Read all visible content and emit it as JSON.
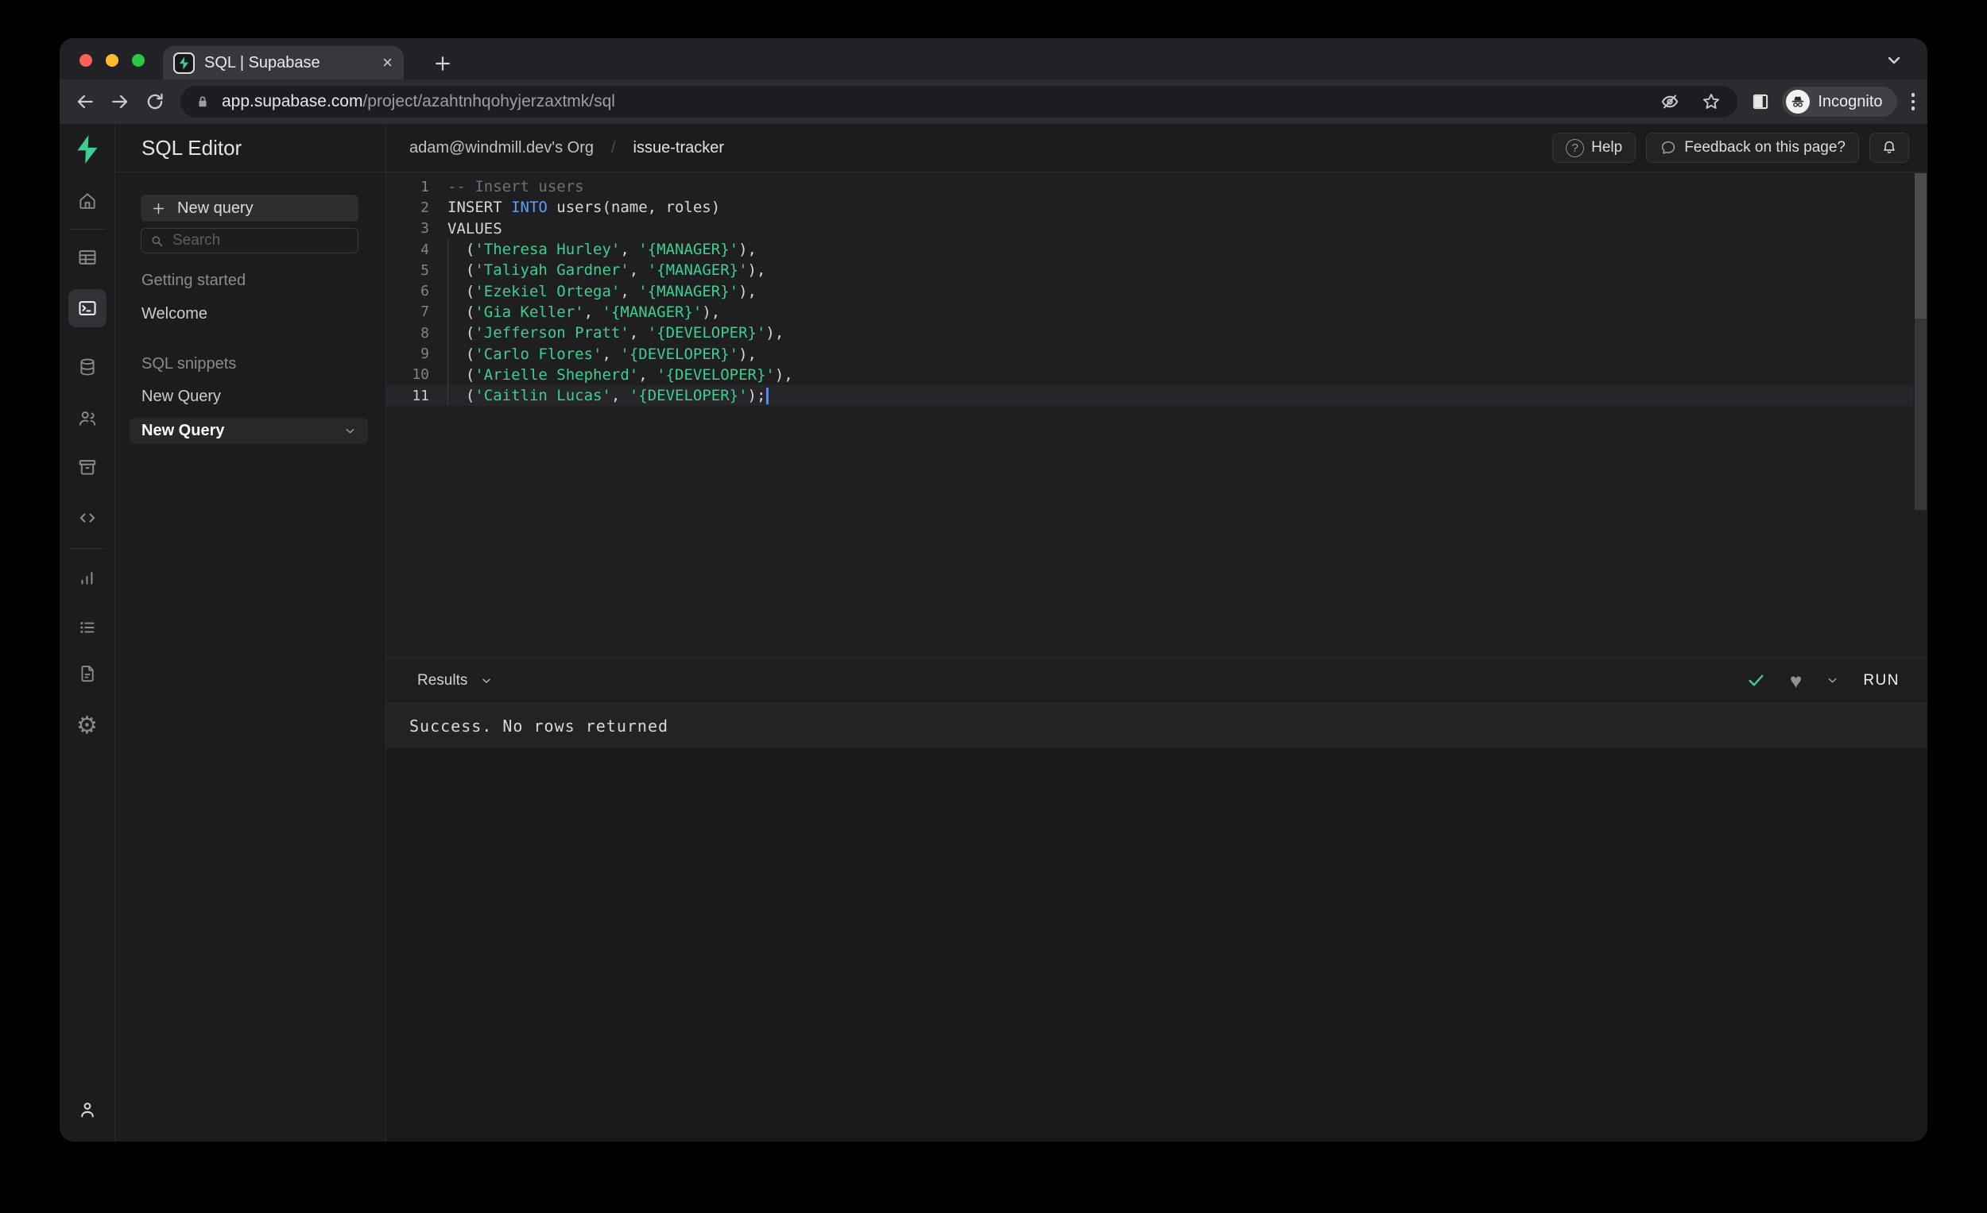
{
  "browser": {
    "tab_title": "SQL | Supabase",
    "url_host": "app.supabase.com",
    "url_path": "/project/azahtnhqohyjerzaxtmk/sql",
    "incognito_label": "Incognito"
  },
  "app": {
    "sidebar": {
      "title": "SQL Editor",
      "new_query_button": "New query",
      "search_placeholder": "Search",
      "sections": [
        {
          "label": "Getting started",
          "items": [
            {
              "label": "Welcome",
              "selected": false
            }
          ]
        },
        {
          "label": "SQL snippets",
          "items": [
            {
              "label": "New Query",
              "selected": false
            },
            {
              "label": "New Query",
              "selected": true
            }
          ]
        }
      ]
    },
    "header": {
      "org": "adam@windmill.dev's Org",
      "separator": "/",
      "project": "issue-tracker",
      "help_button": "Help",
      "feedback_button": "Feedback on this page?"
    },
    "editor": {
      "lines": [
        {
          "num": 1,
          "tokens": [
            {
              "t": "-- Insert users",
              "c": "comment"
            }
          ]
        },
        {
          "num": 2,
          "tokens": [
            {
              "t": "INSERT ",
              "c": "plain"
            },
            {
              "t": "INTO",
              "c": "keyword"
            },
            {
              "t": " users(name, roles)",
              "c": "plain"
            }
          ]
        },
        {
          "num": 3,
          "tokens": [
            {
              "t": "VALUES",
              "c": "plain"
            }
          ]
        },
        {
          "num": 4,
          "tokens": [
            {
              "t": "  (",
              "c": "plain"
            },
            {
              "t": "'Theresa Hurley'",
              "c": "string"
            },
            {
              "t": ", ",
              "c": "plain"
            },
            {
              "t": "'{MANAGER}'",
              "c": "string"
            },
            {
              "t": "),",
              "c": "plain"
            }
          ]
        },
        {
          "num": 5,
          "tokens": [
            {
              "t": "  (",
              "c": "plain"
            },
            {
              "t": "'Taliyah Gardner'",
              "c": "string"
            },
            {
              "t": ", ",
              "c": "plain"
            },
            {
              "t": "'{MANAGER}'",
              "c": "string"
            },
            {
              "t": "),",
              "c": "plain"
            }
          ]
        },
        {
          "num": 6,
          "tokens": [
            {
              "t": "  (",
              "c": "plain"
            },
            {
              "t": "'Ezekiel Ortega'",
              "c": "string"
            },
            {
              "t": ", ",
              "c": "plain"
            },
            {
              "t": "'{MANAGER}'",
              "c": "string"
            },
            {
              "t": "),",
              "c": "plain"
            }
          ]
        },
        {
          "num": 7,
          "tokens": [
            {
              "t": "  (",
              "c": "plain"
            },
            {
              "t": "'Gia Keller'",
              "c": "string"
            },
            {
              "t": ", ",
              "c": "plain"
            },
            {
              "t": "'{MANAGER}'",
              "c": "string"
            },
            {
              "t": "),",
              "c": "plain"
            }
          ]
        },
        {
          "num": 8,
          "tokens": [
            {
              "t": "  (",
              "c": "plain"
            },
            {
              "t": "'Jefferson Pratt'",
              "c": "string"
            },
            {
              "t": ", ",
              "c": "plain"
            },
            {
              "t": "'{DEVELOPER}'",
              "c": "string"
            },
            {
              "t": "),",
              "c": "plain"
            }
          ]
        },
        {
          "num": 9,
          "tokens": [
            {
              "t": "  (",
              "c": "plain"
            },
            {
              "t": "'Carlo Flores'",
              "c": "string"
            },
            {
              "t": ", ",
              "c": "plain"
            },
            {
              "t": "'{DEVELOPER}'",
              "c": "string"
            },
            {
              "t": "),",
              "c": "plain"
            }
          ]
        },
        {
          "num": 10,
          "tokens": [
            {
              "t": "  (",
              "c": "plain"
            },
            {
              "t": "'Arielle Shepherd'",
              "c": "string"
            },
            {
              "t": ", ",
              "c": "plain"
            },
            {
              "t": "'{DEVELOPER}'",
              "c": "string"
            },
            {
              "t": "),",
              "c": "plain"
            }
          ]
        },
        {
          "num": 11,
          "current": true,
          "cursor": true,
          "tokens": [
            {
              "t": "  (",
              "c": "plain"
            },
            {
              "t": "'Caitlin Lucas'",
              "c": "string"
            },
            {
              "t": ", ",
              "c": "plain"
            },
            {
              "t": "'{DEVELOPER}'",
              "c": "string"
            },
            {
              "t": ");",
              "c": "plain"
            }
          ]
        }
      ]
    },
    "results": {
      "label": "Results",
      "message": "Success. No rows returned",
      "run_button": "RUN"
    },
    "rail_icons": [
      "supabase-logo",
      "home",
      "table-editor",
      "sql-editor",
      "database",
      "authentication",
      "storage",
      "edge-functions",
      "reports",
      "logs",
      "docs",
      "settings",
      "account"
    ]
  },
  "colors": {
    "accent_green": "#3ecf8e",
    "keyword_blue": "#5ba0f2",
    "string_green": "#3ecf8e",
    "comment_gray": "#6e7073",
    "caret_blue": "#4e8df6",
    "success_check": "#3ecf8e"
  }
}
